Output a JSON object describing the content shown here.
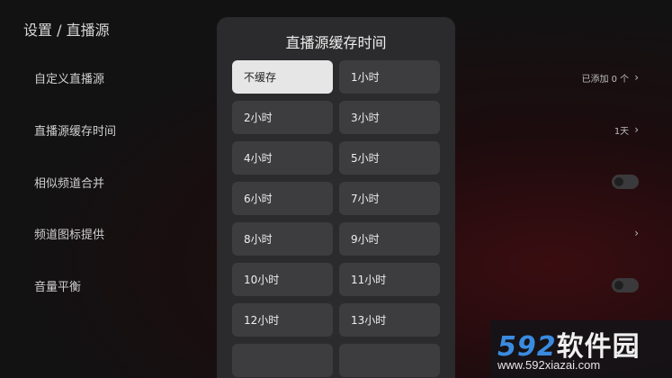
{
  "header": {
    "title": "设置 / 直播源"
  },
  "settings": [
    {
      "label": "自定义直播源",
      "value": "已添加 0 个",
      "control": "chevron"
    },
    {
      "label": "直播源缓存时间",
      "value": "1天",
      "control": "chevron"
    },
    {
      "label": "相似频道合并",
      "value": "",
      "control": "toggle",
      "on": false
    },
    {
      "label": "频道图标提供",
      "value": "",
      "control": "chevron"
    },
    {
      "label": "音量平衡",
      "value": "",
      "control": "toggle",
      "on": false
    }
  ],
  "dialog": {
    "title": "直播源缓存时间",
    "options": [
      "不缓存",
      "1小时",
      "2小时",
      "3小时",
      "4小时",
      "5小时",
      "6小时",
      "7小时",
      "8小时",
      "9小时",
      "10小时",
      "11小时",
      "12小时",
      "13小时",
      "",
      ""
    ],
    "selected_index": 0
  },
  "icons": {
    "chevron": "chevron-right-icon",
    "toggle": "toggle-switch"
  },
  "watermark": {
    "brand_number": "592",
    "brand_text": "软件园",
    "url": "www.592xiazai.com"
  },
  "colors": {
    "selected_option_bg": "#e6e6e6",
    "option_bg": "#3d3d40",
    "dialog_bg": "#2b2b2d",
    "watermark_accent": "#3a8be0"
  }
}
